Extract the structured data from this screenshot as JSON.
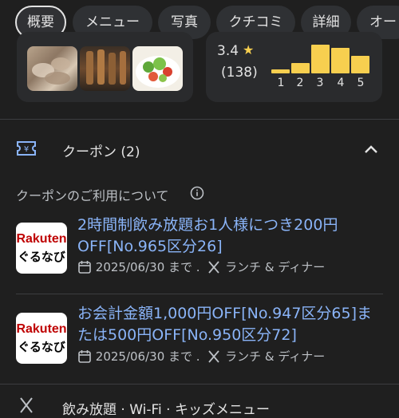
{
  "tabs": [
    "概要",
    "メニュー",
    "写真",
    "クチコミ",
    "詳細",
    "オー"
  ],
  "rating": {
    "score": "3.4",
    "count": "(138)",
    "distribution_labels": [
      "1",
      "2",
      "3",
      "4",
      "5"
    ],
    "distribution_levels": [
      0.15,
      0.35,
      1.0,
      0.9,
      0.6
    ]
  },
  "coupons": {
    "header": "クーポン (2)",
    "about_label": "クーポンのご利用について",
    "items": [
      {
        "logo_top": "Rakuten",
        "logo_bottom": "ぐるなび",
        "title": "2時間制飲み放題お1人様につき200円OFF[No.965区分26]",
        "expiry": "2025/06/30 まで .",
        "service": "ランチ & ディナー"
      },
      {
        "logo_top": "Rakuten",
        "logo_bottom": "ぐるなび",
        "title": "お会計金額1,000円OFF[No.947区分65]または500円OFF[No.950区分72]",
        "expiry": "2025/06/30 まで .",
        "service": "ランチ & ディナー"
      }
    ]
  },
  "amenities_label": "飲み放題 · Wi-Fi · キッズメニュー",
  "colors": {
    "accent": "#8ab4f8",
    "star": "#f7cf4f",
    "background": "#1f1f1f"
  }
}
